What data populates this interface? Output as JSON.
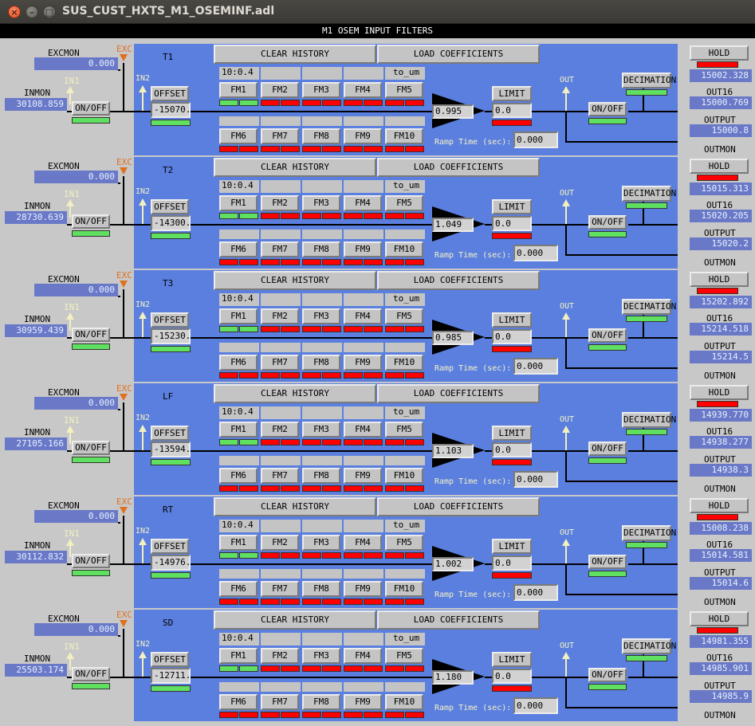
{
  "window": {
    "title": "SUS_CUST_HXTS_M1_OSEMINF.adl",
    "close_glyph": "×",
    "min_glyph": "–",
    "max_glyph": "□"
  },
  "header": "M1 OSEM INPUT FILTERS",
  "labels": {
    "excmon": "EXCMON",
    "exc": "EXC",
    "in1": "IN1",
    "inmon": "INMON",
    "in2": "IN2",
    "out": "OUT",
    "clear_history": "CLEAR HISTORY",
    "load_coefficients": "LOAD COEFFICIENTS",
    "offset": "OFFSET",
    "limit": "LIMIT",
    "on_off": "ON/OFF",
    "ramp_time": "Ramp Time (sec):",
    "decimation": "DECIMATION",
    "hold_output": "HOLD OUTPUT",
    "out16": "OUT16",
    "output": "OUTPUT",
    "outmon": "OUTMON",
    "fm_top": [
      "FM1",
      "FM2",
      "FM3",
      "FM4",
      "FM5"
    ],
    "fm_bottom": [
      "FM6",
      "FM7",
      "FM8",
      "FM9",
      "FM10"
    ]
  },
  "colors": {
    "panel_blue": "#5a7fde",
    "led_on": "#60e060",
    "led_off": "#ff0000",
    "readback": "#6a79c7",
    "exc_orange": "#e07020"
  },
  "channels": [
    {
      "name": "T1",
      "excmon": "0.000",
      "inmon": "30108.859",
      "offset": "-15070.",
      "fm1_name": "10:0.4",
      "fm5_name": "to_um",
      "gain": "0.995",
      "limit": "0.0",
      "ramp": "0.000",
      "hold_out": "15002.328",
      "out16": "15000.769",
      "output": "15000.8"
    },
    {
      "name": "T2",
      "excmon": "0.000",
      "inmon": "28730.639",
      "offset": "-14300.",
      "fm1_name": "10:0.4",
      "fm5_name": "to_um",
      "gain": "1.049",
      "limit": "0.0",
      "ramp": "0.000",
      "hold_out": "15015.313",
      "out16": "15020.205",
      "output": "15020.2"
    },
    {
      "name": "T3",
      "excmon": "0.000",
      "inmon": "30959.439",
      "offset": "-15230.",
      "fm1_name": "10:0.4",
      "fm5_name": "to_um",
      "gain": "0.985",
      "limit": "0.0",
      "ramp": "0.000",
      "hold_out": "15202.892",
      "out16": "15214.518",
      "output": "15214.5"
    },
    {
      "name": "LF",
      "excmon": "0.000",
      "inmon": "27105.166",
      "offset": "-13594.",
      "fm1_name": "10:0.4",
      "fm5_name": "to_um",
      "gain": "1.103",
      "limit": "0.0",
      "ramp": "0.000",
      "hold_out": "14939.770",
      "out16": "14938.277",
      "output": "14938.3"
    },
    {
      "name": "RT",
      "excmon": "0.000",
      "inmon": "30112.832",
      "offset": "-14976.",
      "fm1_name": "10:0.4",
      "fm5_name": "to_um",
      "gain": "1.002",
      "limit": "0.0",
      "ramp": "0.000",
      "hold_out": "15008.238",
      "out16": "15014.581",
      "output": "15014.6"
    },
    {
      "name": "SD",
      "excmon": "0.000",
      "inmon": "25503.174",
      "offset": "-12711.",
      "fm1_name": "10:0.4",
      "fm5_name": "to_um",
      "gain": "1.180",
      "limit": "0.0",
      "ramp": "0.000",
      "hold_out": "14981.355",
      "out16": "14985.901",
      "output": "14985.9"
    }
  ]
}
